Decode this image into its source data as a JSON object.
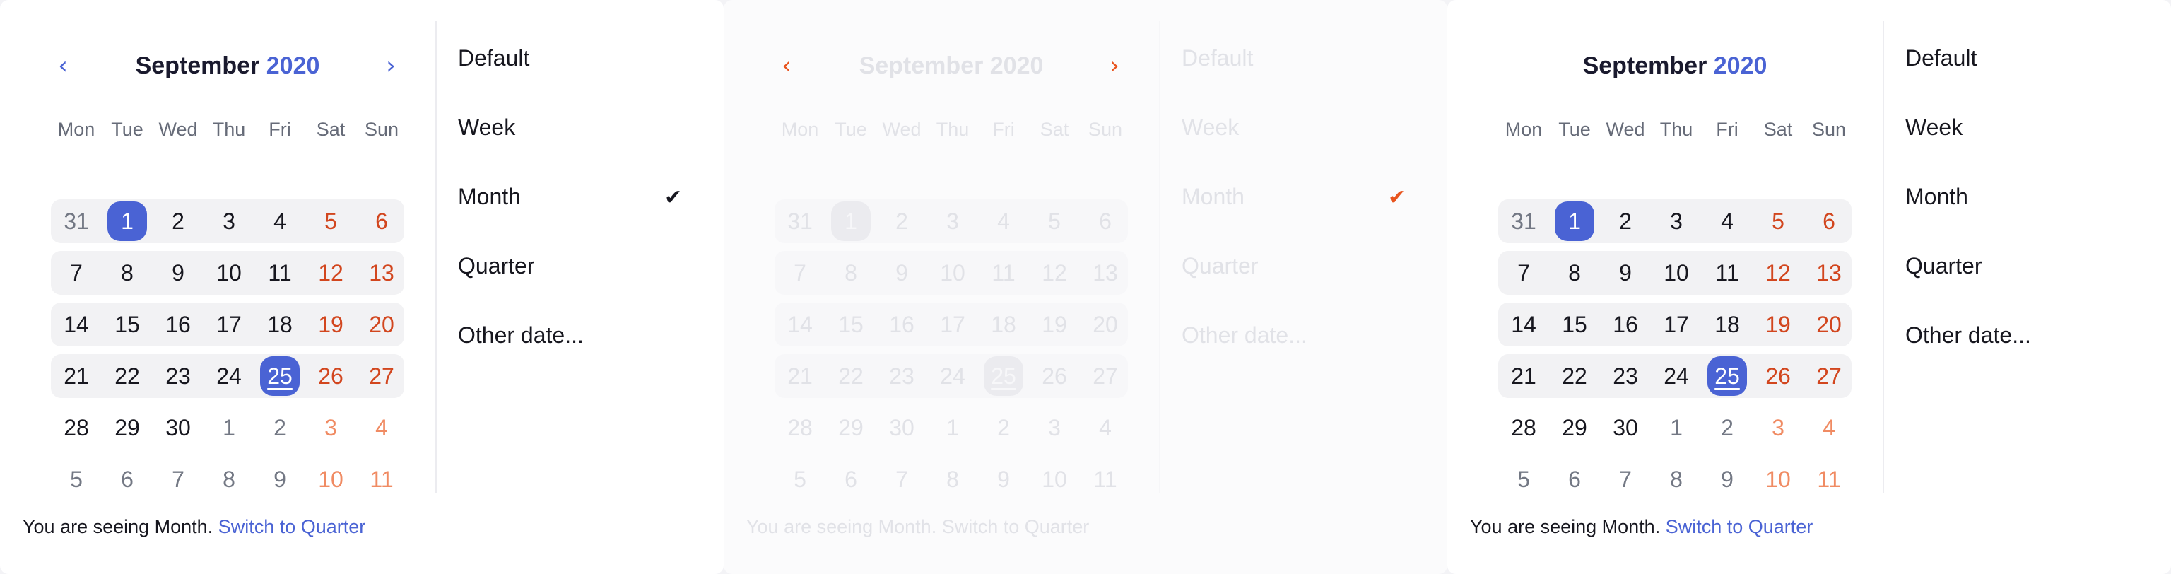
{
  "panels": [
    {
      "id": "p0",
      "state": "default",
      "show_nav": true,
      "calendar": {
        "month": "September",
        "year": "2020",
        "prev_icon": "chevron-left-icon",
        "next_icon": "chevron-right-icon",
        "weekdays": [
          "Mon",
          "Tue",
          "Wed",
          "Thu",
          "Fri",
          "Sat",
          "Sun"
        ],
        "weeks": [
          [
            "31",
            "1",
            "2",
            "3",
            "4",
            "5",
            "6"
          ],
          [
            "7",
            "8",
            "9",
            "10",
            "11",
            "12",
            "13"
          ],
          [
            "14",
            "15",
            "16",
            "17",
            "18",
            "19",
            "20"
          ],
          [
            "21",
            "22",
            "23",
            "24",
            "25",
            "26",
            "27"
          ],
          [
            "28",
            "29",
            "30",
            "1",
            "2",
            "3",
            "4"
          ],
          [
            "5",
            "6",
            "7",
            "8",
            "9",
            "10",
            "11"
          ]
        ],
        "in_month_weeks": [
          0,
          1,
          2,
          3
        ],
        "selected_day": "1",
        "today": "25"
      },
      "options": [
        "Default",
        "Week",
        "Month",
        "Quarter",
        "Other date..."
      ],
      "checked_option": "Month",
      "footer": {
        "text": "You are seeing Month.",
        "link": "Switch to Quarter"
      }
    },
    {
      "id": "p1",
      "state": "disabled",
      "show_nav": true,
      "calendar": {
        "month": "September",
        "year": "2020",
        "prev_icon": "chevron-left-icon",
        "next_icon": "chevron-right-icon",
        "weekdays": [
          "Mon",
          "Tue",
          "Wed",
          "Thu",
          "Fri",
          "Sat",
          "Sun"
        ],
        "weeks": [
          [
            "31",
            "1",
            "2",
            "3",
            "4",
            "5",
            "6"
          ],
          [
            "7",
            "8",
            "9",
            "10",
            "11",
            "12",
            "13"
          ],
          [
            "14",
            "15",
            "16",
            "17",
            "18",
            "19",
            "20"
          ],
          [
            "21",
            "22",
            "23",
            "24",
            "25",
            "26",
            "27"
          ],
          [
            "28",
            "29",
            "30",
            "1",
            "2",
            "3",
            "4"
          ],
          [
            "5",
            "6",
            "7",
            "8",
            "9",
            "10",
            "11"
          ]
        ],
        "in_month_weeks": [
          0,
          1,
          2,
          3
        ],
        "selected_day": "1",
        "today": "25"
      },
      "options": [
        "Default",
        "Week",
        "Month",
        "Quarter",
        "Other date..."
      ],
      "checked_option": "Month",
      "footer": {
        "text": "You are seeing Month.",
        "link": "Switch to Quarter"
      }
    },
    {
      "id": "p2",
      "state": "default",
      "show_nav": false,
      "calendar": {
        "month": "September",
        "year": "2020",
        "weekdays": [
          "Mon",
          "Tue",
          "Wed",
          "Thu",
          "Fri",
          "Sat",
          "Sun"
        ],
        "weeks": [
          [
            "31",
            "1",
            "2",
            "3",
            "4",
            "5",
            "6"
          ],
          [
            "7",
            "8",
            "9",
            "10",
            "11",
            "12",
            "13"
          ],
          [
            "14",
            "15",
            "16",
            "17",
            "18",
            "19",
            "20"
          ],
          [
            "21",
            "22",
            "23",
            "24",
            "25",
            "26",
            "27"
          ],
          [
            "28",
            "29",
            "30",
            "1",
            "2",
            "3",
            "4"
          ],
          [
            "5",
            "6",
            "7",
            "8",
            "9",
            "10",
            "11"
          ]
        ],
        "in_month_weeks": [
          0,
          1,
          2,
          3
        ],
        "selected_day": "1",
        "today": "25"
      },
      "options": [
        "Default",
        "Week",
        "Month",
        "Quarter",
        "Other date..."
      ],
      "checked_option": "",
      "footer": {
        "text": "You are seeing Month.",
        "link": "Switch to Quarter"
      }
    }
  ],
  "check_icon": "checkmark-icon",
  "colors": {
    "accent": "#4a63d4",
    "weekend": "#d2461e",
    "weekend_muted": "#f08b63",
    "disabled_accent": "#e8541e"
  }
}
